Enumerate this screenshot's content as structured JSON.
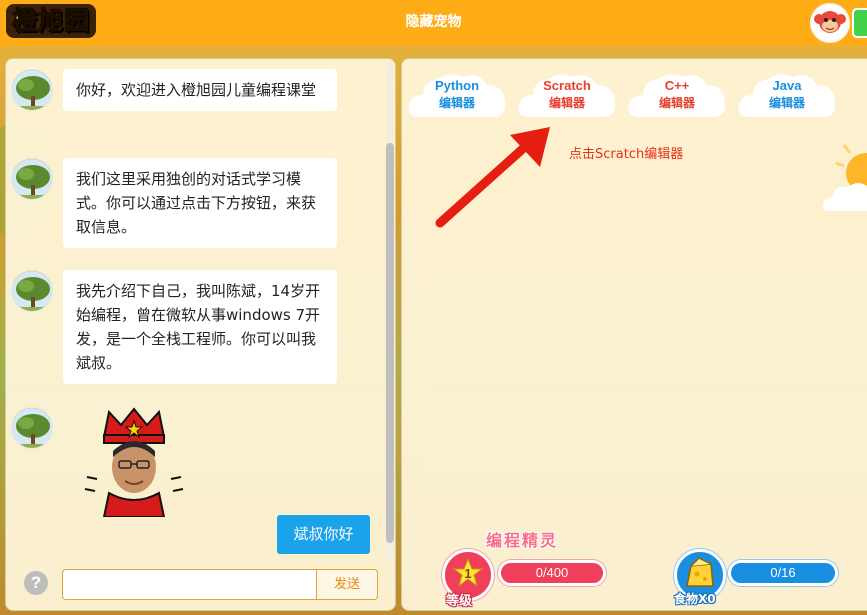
{
  "header": {
    "logo_text": "橙旭园",
    "title": "隐藏宠物"
  },
  "chat": {
    "messages": [
      {
        "text": "你好，欢迎进入橙旭园儿童编程课堂"
      },
      {
        "text": "我们这里采用独创的对话式学习模式。你可以通过点击下方按钮，来获取信息。"
      },
      {
        "text": "我先介绍下自己，我叫陈斌，14岁开始编程，曾在微软从事windows 7开发，是一个全栈工程师。你可以叫我斌叔。"
      }
    ],
    "reply_button": "斌叔你好",
    "input_value": "",
    "send_button": "发送",
    "help_icon": "?",
    "scroll_position": 0.8
  },
  "editors": [
    {
      "name": "Python",
      "label": "编辑器",
      "highlight": false
    },
    {
      "name": "Scratch",
      "label": "编辑器",
      "highlight": true
    },
    {
      "name": "C++",
      "label": "编辑器",
      "highlight": false
    },
    {
      "name": "Java",
      "label": "编辑器",
      "highlight": false
    }
  ],
  "hint": "点击Scratch编辑器",
  "stats": {
    "spirit_title": "编程精灵",
    "level": "1",
    "level_label": "等级",
    "xp_text": "0/400",
    "xp_progress": 0,
    "food_label": "食物X0",
    "food_text": "0/16",
    "food_progress": 0
  },
  "colors": {
    "topbar": "#ffad17",
    "accent_blue": "#1aa2ea",
    "highlight_red": "#e8402e",
    "xp_pink": "#ef3f5a",
    "food_blue": "#1a8ee0"
  }
}
